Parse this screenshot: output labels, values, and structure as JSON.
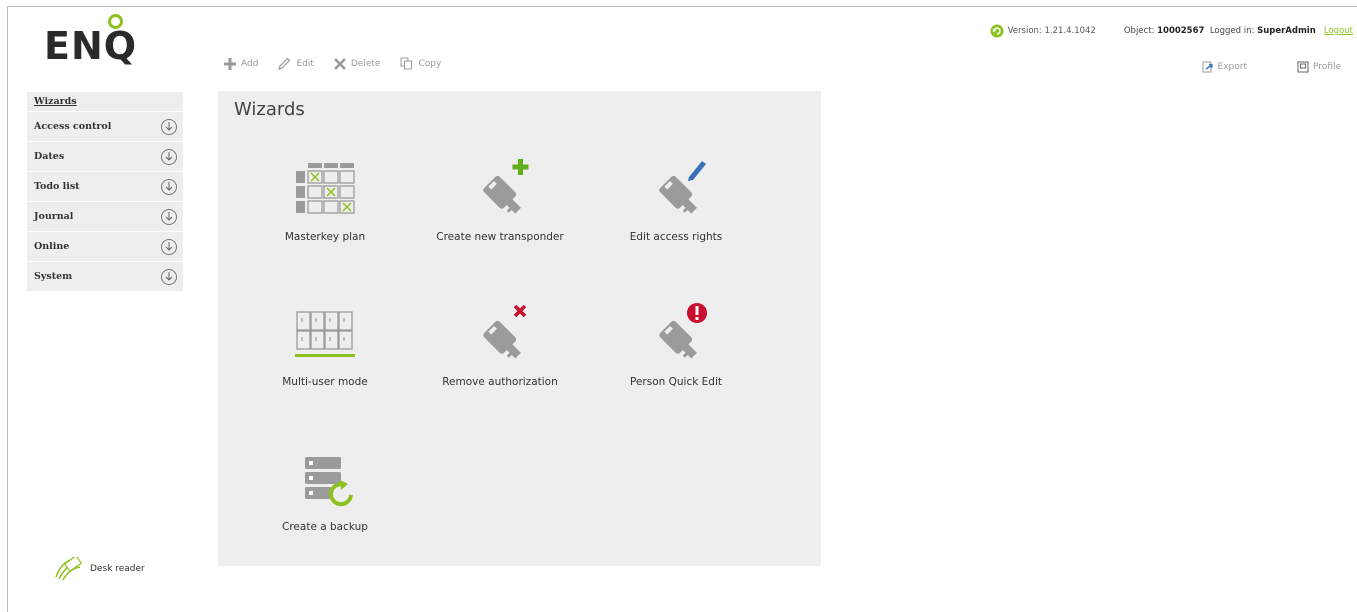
{
  "app": {
    "logo_text": "ENiQ"
  },
  "toolbar": {
    "add": "Add",
    "edit": "Edit",
    "delete": "Delete",
    "copy": "Copy"
  },
  "header": {
    "version_label": "Version: 1.21.4.1042",
    "object_label": "Object:",
    "object_value": "10002567",
    "logged_label": "Logged in:",
    "logged_user": "SuperAdmin",
    "logout": "Logout",
    "export": "Export",
    "profile": "Profile"
  },
  "sidebar": {
    "items": [
      {
        "label": "Wizards"
      },
      {
        "label": "Access control"
      },
      {
        "label": "Dates"
      },
      {
        "label": "Todo list"
      },
      {
        "label": "Journal"
      },
      {
        "label": "Online"
      },
      {
        "label": "System"
      }
    ],
    "desk_reader": "Desk reader"
  },
  "main": {
    "title": "Wizards",
    "tiles": [
      {
        "label": "Masterkey plan"
      },
      {
        "label": "Create new transponder"
      },
      {
        "label": "Edit access rights"
      },
      {
        "label": "Multi-user mode"
      },
      {
        "label": "Remove authorization"
      },
      {
        "label": "Person Quick Edit"
      },
      {
        "label": "Create a backup"
      }
    ]
  },
  "colors": {
    "accent_green": "#8cc11f",
    "alert_red": "#c8102e",
    "edit_blue": "#3b6fb6",
    "icon_gray": "#9b9b9b"
  }
}
